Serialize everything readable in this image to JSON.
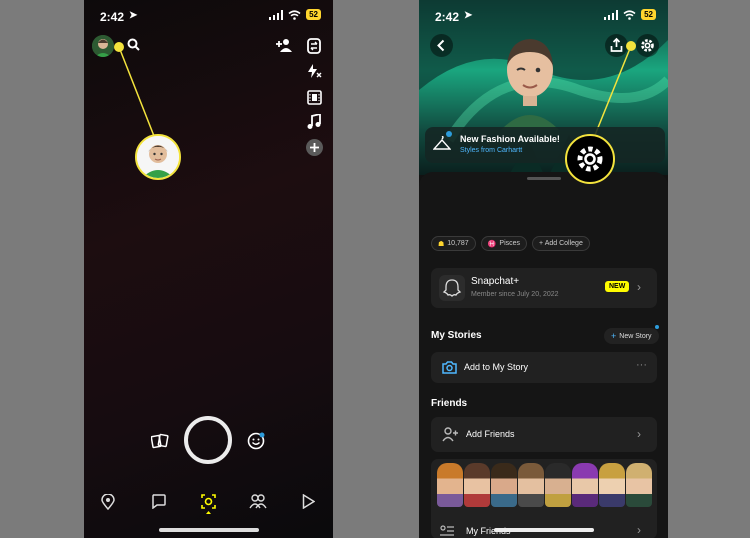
{
  "left_screen": {
    "status": {
      "time": "2:42",
      "battery": "52"
    },
    "top_icons": [
      "avatar",
      "search-icon",
      "add-friend-icon"
    ],
    "right_rail": [
      "flip-camera-icon",
      "flash-off-icon",
      "video-icon",
      "music-icon",
      "plus-icon"
    ],
    "bottom_nav": [
      "map-icon",
      "chat-icon",
      "camera-icon",
      "friends-icon",
      "stories-icon"
    ]
  },
  "right_screen": {
    "status": {
      "time": "2:42",
      "battery": "52"
    },
    "fashion": {
      "title": "New Fashion Available!",
      "subtitle": "Styles from Carhartt"
    },
    "pills": {
      "score": "10,787",
      "zodiac": "Pisces",
      "college": "+ Add College"
    },
    "snapchat_plus": {
      "title": "Snapchat+",
      "subtitle": "Member since July 20, 2022",
      "badge": "NEW"
    },
    "my_stories": {
      "heading": "My Stories",
      "new_story": "New Story",
      "add_story": "Add to My Story",
      "more": "···"
    },
    "friends": {
      "heading": "Friends",
      "add_friends": "Add Friends",
      "my_friends": "My Friends"
    }
  },
  "colors": {
    "callout": "#f3e33d",
    "snap_yellow": "#fffc00",
    "link_blue": "#4fb8ff"
  }
}
